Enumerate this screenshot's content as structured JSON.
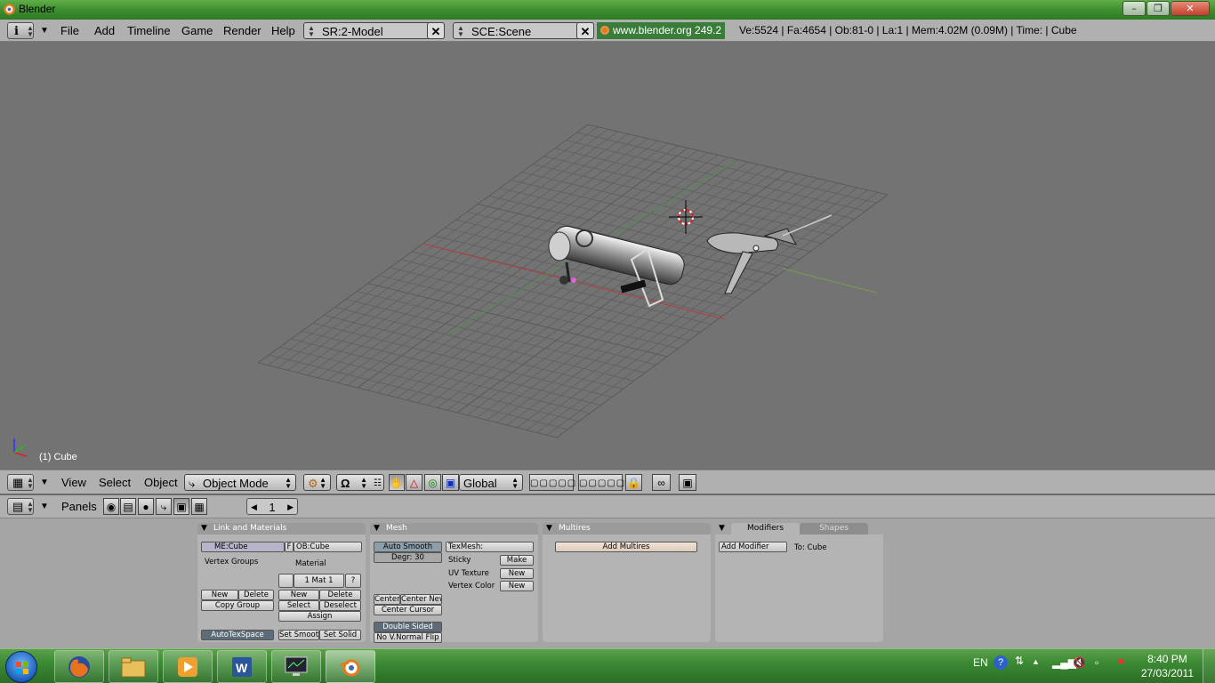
{
  "window": {
    "title": "Blender"
  },
  "header": {
    "menus": [
      "File",
      "Add",
      "Timeline",
      "Game",
      "Render",
      "Help"
    ],
    "screen": "SR:2-Model",
    "scene": "SCE:Scene",
    "url": "www.blender.org 249.2",
    "stats": "Ve:5524 | Fa:4654 | Ob:81-0 | La:1  | Mem:4.02M (0.09M)  | Time: | Cube"
  },
  "viewport": {
    "object_label": "(1) Cube"
  },
  "view_header": {
    "menus": [
      "View",
      "Select",
      "Object"
    ],
    "mode": "Object Mode",
    "orientation": "Global"
  },
  "buttons_header": {
    "label": "Panels",
    "frame": "1"
  },
  "panels": {
    "link_materials": {
      "title": "Link and Materials",
      "mesh_name": "ME:Cube",
      "f_label": "F",
      "object_name": "OB:Cube",
      "vertex_groups": "Vertex Groups",
      "material": "Material",
      "mat_index": "1 Mat 1",
      "q": "?",
      "vg_new": "New",
      "vg_delete": "Delete",
      "copy_group": "Copy Group",
      "mat_new": "New",
      "mat_delete": "Delete",
      "mat_select": "Select",
      "mat_deselect": "Deselect",
      "assign": "Assign",
      "autotexspace": "AutoTexSpace",
      "set_smooth": "Set Smoot",
      "set_solid": "Set Solid"
    },
    "mesh": {
      "title": "Mesh",
      "auto_smooth": "Auto Smooth",
      "degr": "Degr: 30",
      "texmesh": "TexMesh:",
      "sticky": "Sticky",
      "sticky_btn": "Make",
      "uv_texture": "UV Texture",
      "uv_btn": "New",
      "vertex_color": "Vertex Color",
      "vc_btn": "New",
      "center": "Center",
      "center_new": "Center New",
      "center_cursor": "Center Cursor",
      "double_sided": "Double Sided",
      "no_vnormal_flip": "No V.Normal Flip"
    },
    "multires": {
      "title": "Multires",
      "add": "Add Multires"
    },
    "modifiers": {
      "tab1": "Modifiers",
      "tab2": "Shapes",
      "add": "Add Modifier",
      "to": "To: Cube"
    }
  },
  "taskbar": {
    "lang": "EN",
    "time": "8:40 PM",
    "date": "27/03/2011"
  },
  "colors": {
    "taskbar": "#3c8a34",
    "viewport": "#737373",
    "buttons_bg": "#a5a5a5",
    "url_bg": "#3a7d3a"
  }
}
